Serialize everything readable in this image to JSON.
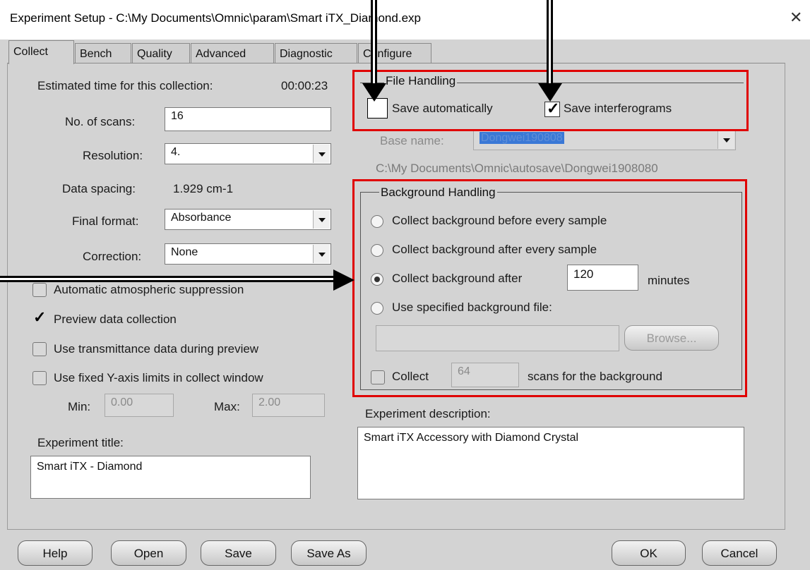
{
  "window": {
    "title": "Experiment Setup - C:\\My Documents\\Omnic\\param\\Smart iTX_Diamond.exp",
    "close_glyph": "✕"
  },
  "tabs": [
    {
      "label": "Collect",
      "active": true
    },
    {
      "label": "Bench",
      "active": false
    },
    {
      "label": "Quality",
      "active": false
    },
    {
      "label": "Advanced",
      "active": false
    },
    {
      "label": "Diagnostic",
      "active": false
    },
    {
      "label": "Configure",
      "active": false
    }
  ],
  "collect": {
    "estimated_time_label": "Estimated time for this collection:",
    "estimated_time_value": "00:00:23",
    "scans_label": "No. of scans:",
    "scans_value": "16",
    "resolution_label": "Resolution:",
    "resolution_value": "4.",
    "data_spacing_label": "Data spacing:",
    "data_spacing_value": "1.929 cm-1",
    "final_format_label": "Final format:",
    "final_format_value": "Absorbance",
    "correction_label": "Correction:",
    "correction_value": "None",
    "options": [
      {
        "label": "Automatic atmospheric suppression",
        "checked": false
      },
      {
        "label": "Preview data collection",
        "checked": true
      },
      {
        "label": "Use transmittance data during preview",
        "checked": false
      },
      {
        "label": "Use fixed Y-axis limits in collect window",
        "checked": false
      }
    ],
    "min_label": "Min:",
    "min_value": "0.00",
    "max_label": "Max:",
    "max_value": "2.00",
    "experiment_title_label": "Experiment title:",
    "experiment_title_value": "Smart iTX - Diamond"
  },
  "file_handling": {
    "title": "File Handling",
    "save_automatically_label": "Save automatically",
    "save_automatically_checked": false,
    "save_interferograms_label": "Save interferograms",
    "save_interferograms_checked": true,
    "base_name_label": "Base name:",
    "base_name_value": "Dongwei190808",
    "path": "C:\\My Documents\\Omnic\\autosave\\Dongwei1908080"
  },
  "background": {
    "title": "Background Handling",
    "radio_before": "Collect background before every sample",
    "radio_after_every": "Collect background after every sample",
    "radio_after_minutes": "Collect background after",
    "minutes_value": "120",
    "minutes_unit": "minutes",
    "radio_file": "Use specified background file:",
    "selected": "after_minutes",
    "file_value": "",
    "browse_label": "Browse...",
    "collect_label": "Collect",
    "collect_scans_value": "64",
    "collect_scans_suffix": "scans for the background"
  },
  "description": {
    "label": "Experiment description:",
    "value": "Smart iTX Accessory with Diamond Crystal"
  },
  "buttons": {
    "help": "Help",
    "open": "Open",
    "save": "Save",
    "save_as": "Save As",
    "ok": "OK",
    "cancel": "Cancel"
  },
  "colors": {
    "annotation_red": "#e00000",
    "dialog_gray": "#d3d3d3",
    "selection_blue": "#3a78d6"
  }
}
